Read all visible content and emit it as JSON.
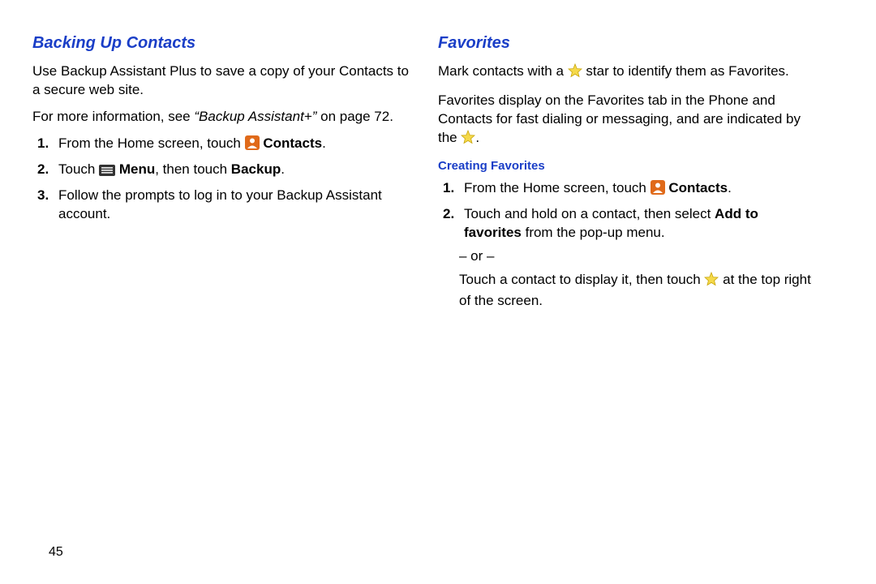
{
  "left": {
    "heading": "Backing Up Contacts",
    "intro1": "Use Backup Assistant Plus to save a copy of your Contacts to a secure web site.",
    "intro2a": "For more information, see ",
    "intro2b": "“Backup Assistant+”",
    "intro2c": " on page 72.",
    "step1a": "From the Home screen, touch ",
    "step1b": "Contacts",
    "step1c": ".",
    "step2a": "Touch ",
    "step2b": "Menu",
    "step2c": ", then touch ",
    "step2d": "Backup",
    "step2e": ".",
    "step3": "Follow the prompts to log in to your Backup Assistant account."
  },
  "right": {
    "heading": "Favorites",
    "p1a": "Mark contacts with a ",
    "p1b": " star to identify them as Favorites.",
    "p2a": "Favorites display on the Favorites tab in the Phone and Contacts for fast dialing or messaging, and are indicated by the ",
    "p2b": ".",
    "subheading": "Creating Favorites",
    "s1a": "From the Home screen, touch ",
    "s1b": "Contacts",
    "s1c": ".",
    "s2a": "Touch and hold on a contact, then select ",
    "s2b": "Add to favorites",
    "s2c": " from the pop-up menu.",
    "or": "– or –",
    "s3a": "Touch a contact to display it, then touch ",
    "s3b": " at the top right of the screen."
  },
  "pagenum": "45"
}
